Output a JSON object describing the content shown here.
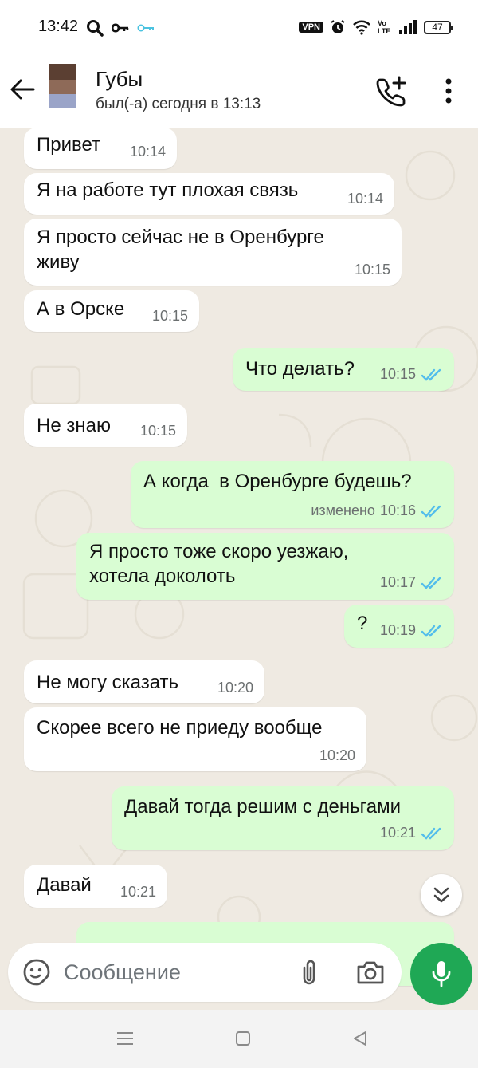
{
  "status_bar": {
    "time": "13:42",
    "vpn": "VPN",
    "volte": "Vo LTE",
    "battery": "47"
  },
  "header": {
    "contact_name": "Губы",
    "last_seen": "был(-а) сегодня в 13:13"
  },
  "messages": [
    {
      "direction": "in",
      "text": "Привет",
      "time": "10:14"
    },
    {
      "direction": "in",
      "text": "Я на работе тут плохая связь",
      "time": "10:14"
    },
    {
      "direction": "in",
      "text": "Я просто сейчас не в Оренбурге\nживу",
      "time": "10:15"
    },
    {
      "direction": "in",
      "text": "А в Орске",
      "time": "10:15"
    },
    {
      "direction": "out",
      "text": "Что делать?",
      "time": "10:15",
      "status": "read"
    },
    {
      "direction": "in",
      "text": "Не знаю",
      "time": "10:15"
    },
    {
      "direction": "out",
      "text": "А когда  в Оренбурге будешь?",
      "edited": "изменено",
      "time": "10:16",
      "status": "read"
    },
    {
      "direction": "out",
      "text": "Я просто тоже скоро уезжаю,\nхотела доколоть",
      "time": "10:17",
      "status": "read"
    },
    {
      "direction": "out",
      "text": "?",
      "time": "10:19",
      "status": "read"
    },
    {
      "direction": "in",
      "text": "Не могу сказать",
      "time": "10:20"
    },
    {
      "direction": "in",
      "text": "Скорее всего не приеду вообще",
      "time": "10:20"
    },
    {
      "direction": "out",
      "text": "Давай тогда решим с деньгами",
      "time": "10:21",
      "status": "read"
    },
    {
      "direction": "in",
      "text": "Давай",
      "time": "10:21"
    }
  ],
  "input": {
    "placeholder": "Сообщение"
  },
  "colors": {
    "incoming_bubble": "#ffffff",
    "outgoing_bubble": "#d9fdd3",
    "read_ticks": "#53bdeb",
    "mic_button": "#1fa855",
    "chat_background": "#efeae2"
  }
}
